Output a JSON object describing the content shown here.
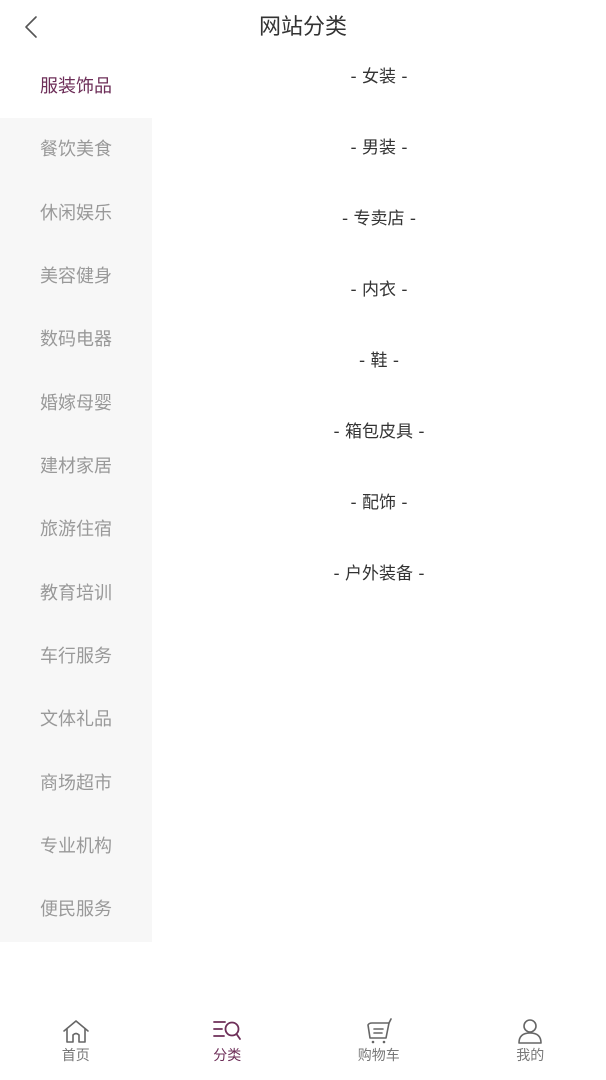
{
  "header": {
    "title": "网站分类"
  },
  "sidebar": {
    "items": [
      {
        "label": "服装饰品",
        "active": true
      },
      {
        "label": "餐饮美食"
      },
      {
        "label": "休闲娱乐"
      },
      {
        "label": "美容健身"
      },
      {
        "label": "数码电器"
      },
      {
        "label": "婚嫁母婴"
      },
      {
        "label": "建材家居"
      },
      {
        "label": "旅游住宿"
      },
      {
        "label": "教育培训"
      },
      {
        "label": "车行服务"
      },
      {
        "label": "文体礼品"
      },
      {
        "label": "商场超市"
      },
      {
        "label": "专业机构"
      },
      {
        "label": "便民服务"
      }
    ]
  },
  "subcategories": [
    "- 女装 -",
    "- 男装 -",
    "- 专卖店 -",
    "- 内衣 -",
    "- 鞋 -",
    "- 箱包皮具 -",
    "- 配饰 -",
    "- 户外装备 -"
  ],
  "tabbar": {
    "tabs": [
      {
        "label": "首页",
        "icon": "home-icon"
      },
      {
        "label": "分类",
        "icon": "category-search-icon",
        "active": true
      },
      {
        "label": "购物车",
        "icon": "cart-icon"
      },
      {
        "label": "我的",
        "icon": "user-icon"
      }
    ]
  },
  "colors": {
    "accent": "#6d2e58",
    "sidebar_bg": "#f7f7f7",
    "inactive_text": "#999999"
  }
}
